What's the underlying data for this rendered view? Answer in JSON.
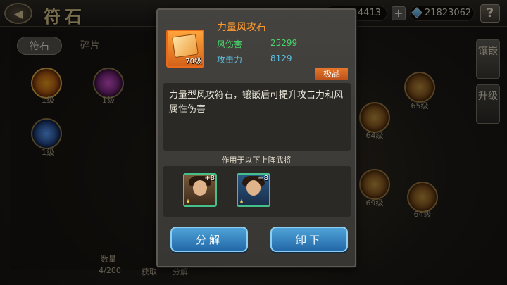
{
  "header": {
    "title": "符石",
    "back_icon": "back-arrow-icon",
    "coins": "14413",
    "gems": "21823062",
    "help_label": "?"
  },
  "tabs": [
    {
      "label": "符石",
      "active": true
    },
    {
      "label": "碎片",
      "active": false
    }
  ],
  "inventory": {
    "runes": [
      {
        "level": "1级",
        "color": "fire"
      },
      {
        "level": "1级",
        "color": "purple"
      },
      {
        "level": "1级",
        "color": "blue"
      }
    ],
    "count_label": "数量",
    "count_value": "4/200",
    "obtain_label": "获取",
    "decompose_label": "分解"
  },
  "side_buttons": [
    {
      "label": "镶嵌"
    },
    {
      "label": "升级"
    }
  ],
  "slots": [
    {
      "level": "65级"
    },
    {
      "level": "64级"
    },
    {
      "level": "69级"
    },
    {
      "level": "64级"
    }
  ],
  "popup": {
    "item": {
      "name": "力量风攻石",
      "level": "70级",
      "quality": "极品",
      "stats": [
        {
          "label": "风伤害",
          "value": "25299",
          "color": "#48d46a"
        },
        {
          "label": "攻击力",
          "value": "8129",
          "color": "#5ac4e8"
        }
      ],
      "description": "力量型风攻符石，镶嵌后可提升攻击力和风属性伤害"
    },
    "heroes_caption": "作用于以下上阵武将",
    "heroes": [
      {
        "badge": "+8"
      },
      {
        "badge": "+8"
      }
    ],
    "buttons": {
      "decompose": "分解",
      "unequip": "卸下"
    }
  }
}
